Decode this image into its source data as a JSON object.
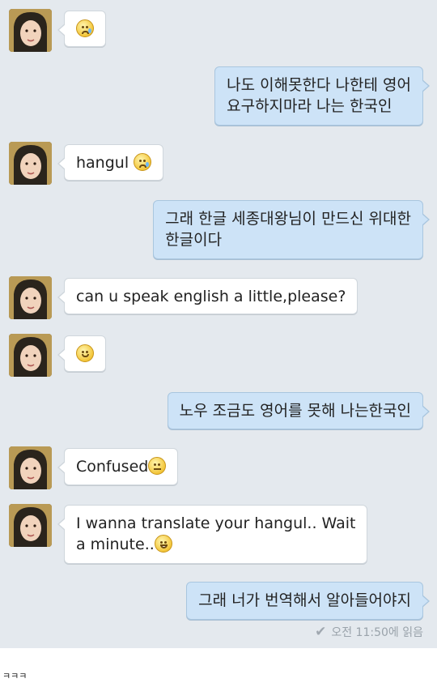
{
  "messages": [
    {
      "from": "them",
      "text": "",
      "emoji": "sad-tear"
    },
    {
      "from": "me",
      "lines": [
        "나도 이해못한다 나한테 영어",
        "요구하지마라 나는 한국인"
      ]
    },
    {
      "from": "them",
      "text": "hangul ",
      "emoji": "sad-tear"
    },
    {
      "from": "me",
      "lines": [
        "그래 한글 세종대왕님이 만드신 위대한",
        "한글이다"
      ]
    },
    {
      "from": "them",
      "text": "can u speak english a little,please?"
    },
    {
      "from": "them",
      "text": "",
      "emoji": "smile"
    },
    {
      "from": "me",
      "lines": [
        "노우 조금도 영어를 못해 나는한국인"
      ]
    },
    {
      "from": "them",
      "text": "Confused",
      "emoji": "flat"
    },
    {
      "from": "them",
      "lines": [
        "I wanna translate your hangul.. Wait",
        "a minute.."
      ],
      "emoji": "grin"
    },
    {
      "from": "me",
      "lines": [
        "그래 너가 번역해서 알아들어야지"
      ]
    }
  ],
  "read_receipt": "오전 11:50에 읽음",
  "caption": "ㅋㅋㅋ",
  "colors": {
    "background": "#e4e9ee",
    "incoming": "#ffffff",
    "outgoing": "#cde3f7"
  }
}
